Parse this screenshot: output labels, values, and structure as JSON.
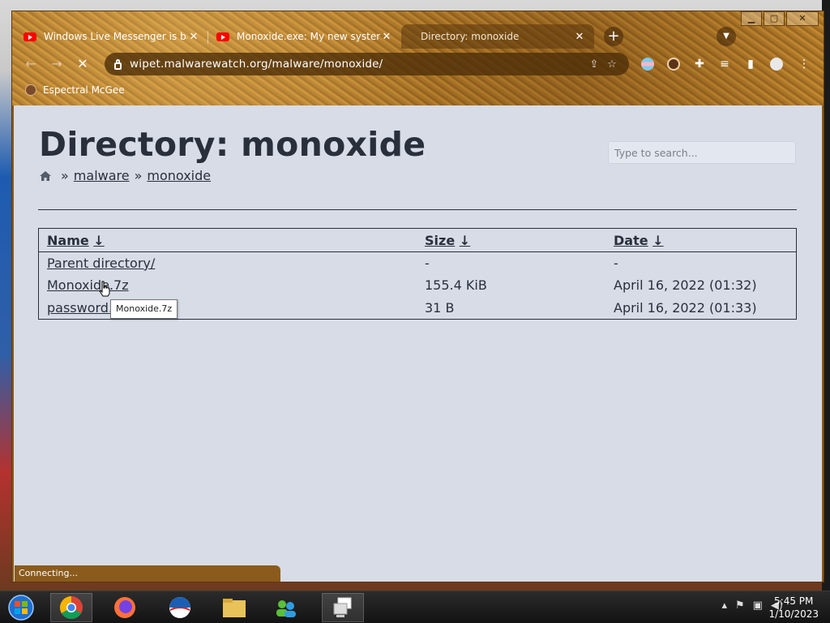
{
  "browser": {
    "tabs": [
      {
        "title": "Windows Live Messenger is back",
        "icon": "youtube-icon",
        "active": false
      },
      {
        "title": "Monoxide.exe: My new system de...",
        "icon": "youtube-icon",
        "active": false
      },
      {
        "title": "Directory: monoxide",
        "icon": "none",
        "active": true
      }
    ],
    "new_tab_label": "+",
    "url": "wipet.malwarewatch.org/malware/monoxide/",
    "bookmark": "Espectral McGee",
    "status": "Connecting..."
  },
  "page": {
    "title": "Directory: monoxide",
    "search_placeholder": "Type to search...",
    "breadcrumb": [
      "malware",
      "monoxide"
    ],
    "breadcrumb_sep": "»",
    "columns": [
      "Name",
      "Size",
      "Date"
    ],
    "sort_arrow": "↓",
    "rows": [
      {
        "name": "Parent directory/",
        "size": "-",
        "date": "-"
      },
      {
        "name": "Monoxide.7z",
        "size": "155.4 KiB",
        "date": "April 16, 2022 (01:32)"
      },
      {
        "name": "password.",
        "size": "31 B",
        "date": "April 16, 2022 (01:33)"
      }
    ],
    "tooltip": "Monoxide.7z"
  },
  "taskbar": {
    "apps": [
      "start-button",
      "chrome-icon",
      "firefox-icon",
      "obama-logo-icon",
      "file-explorer-icon",
      "network-users-icon",
      "remote-desktop-icon"
    ],
    "time": "5:45 PM",
    "date": "1/10/2023"
  }
}
